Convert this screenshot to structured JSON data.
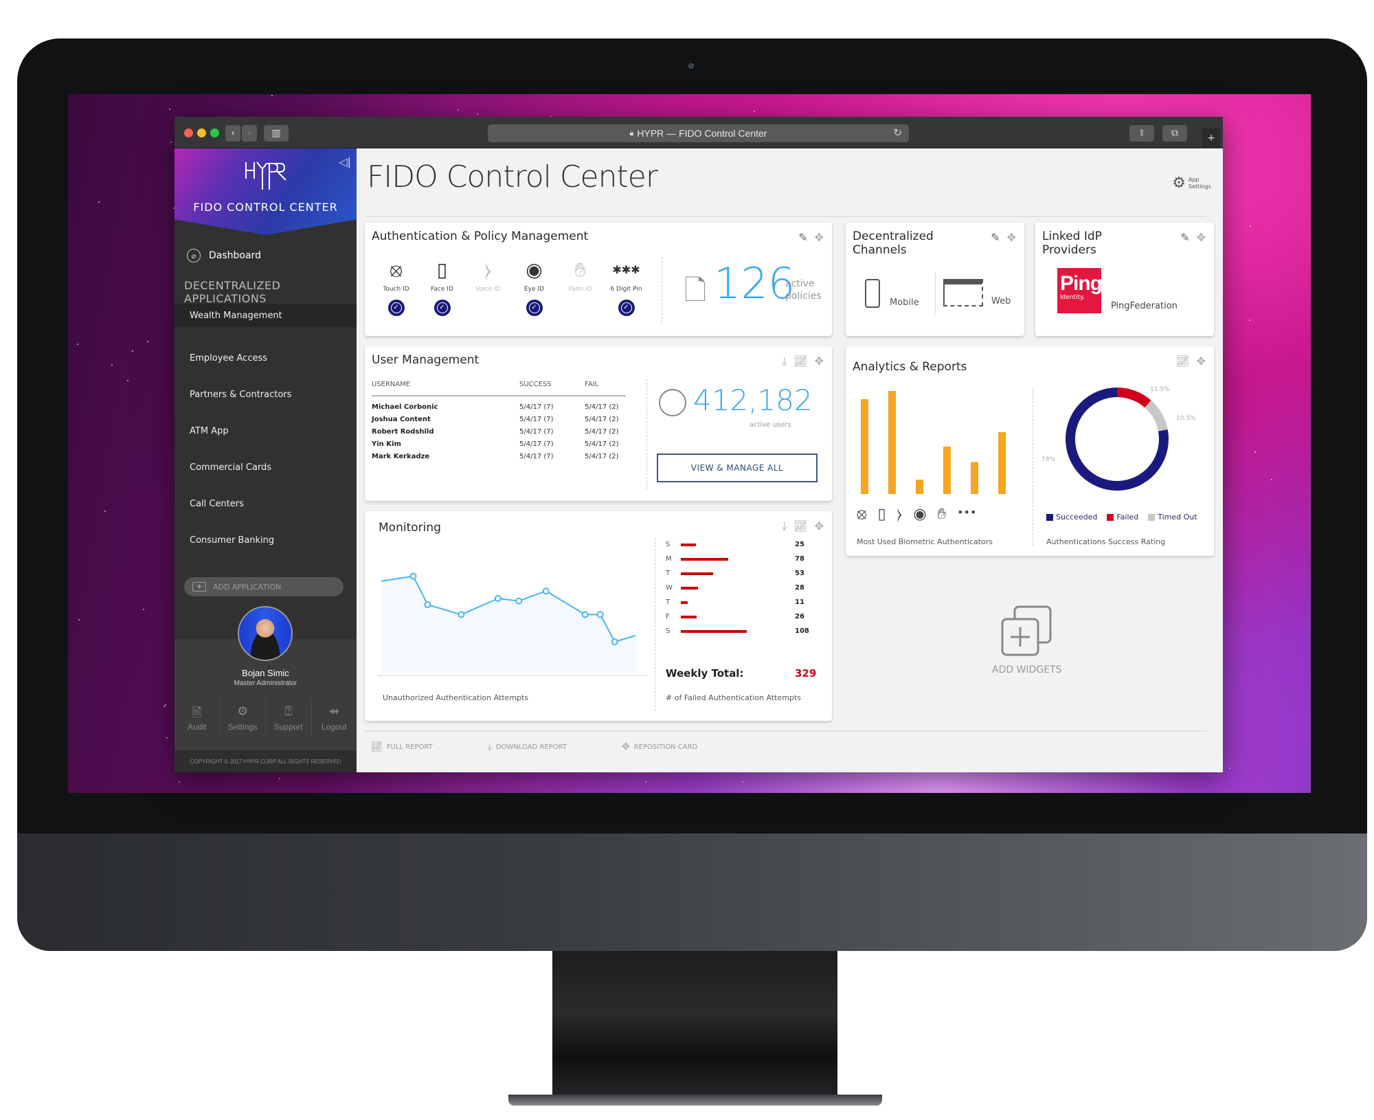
{
  "browser": {
    "url_title": "HYPR — FIDO Control Center",
    "traffic_lights": [
      "#fe5f57",
      "#febc2e",
      "#28c840"
    ]
  },
  "sidebar": {
    "brand_logo": "HYPR",
    "brand_title": "FIDO CONTROL CENTER",
    "dashboard_label": "Dashboard",
    "section_title": "DECENTRALIZED APPLICATIONS",
    "apps": [
      {
        "label": "Wealth Management",
        "active": true
      },
      {
        "label": "Employee Access"
      },
      {
        "label": "Partners & Contractors"
      },
      {
        "label": "ATM App"
      },
      {
        "label": "Commercial Cards"
      },
      {
        "label": "Call Centers"
      },
      {
        "label": "Consumer Banking"
      }
    ],
    "add_application_label": "ADD APPLICATION",
    "user": {
      "name": "Bojan Simic",
      "role": "Master Administrator"
    },
    "actions": [
      {
        "label": "Audit",
        "icon": "audit-icon"
      },
      {
        "label": "Settings",
        "icon": "gear-icon"
      },
      {
        "label": "Support",
        "icon": "help-icon"
      },
      {
        "label": "Logout",
        "icon": "logout-icon"
      }
    ],
    "copyright": "COPYRIGHT © 2017 HYPR CORP ALL RIGHTS RESERVED"
  },
  "main": {
    "page_title": "FIDO Control Center",
    "app_settings_label": "App Settings",
    "auth_policy": {
      "title": "Authentication & Policy Management",
      "methods": [
        {
          "label": "Touch ID",
          "icon": "fingerprint-icon",
          "enabled": true
        },
        {
          "label": "Face ID",
          "icon": "face-icon",
          "enabled": true
        },
        {
          "label": "Voice ID",
          "icon": "voice-icon",
          "enabled": false
        },
        {
          "label": "Eye ID",
          "icon": "eye-icon",
          "enabled": true
        },
        {
          "label": "Palm ID",
          "icon": "palm-icon",
          "enabled": false
        },
        {
          "label": "6 Digit Pin",
          "icon": "pin-icon",
          "enabled": true
        }
      ],
      "active_policies_count": "126",
      "active_policies_label1": "active",
      "active_policies_label2": "policies"
    },
    "channels": {
      "title": "Decentralized Channels",
      "items": [
        {
          "label": "Mobile"
        },
        {
          "label": "Web"
        }
      ]
    },
    "idp": {
      "title": "Linked IdP Providers",
      "logo_text": "Ping",
      "logo_sub": "Identity.",
      "provider_name": "PingFederation",
      "brand_color": "#e4173e"
    },
    "user_mgmt": {
      "title": "User Management",
      "columns": [
        "USERNAME",
        "SUCCESS",
        "FAIL"
      ],
      "rows": [
        {
          "name": "Michael Corbonic",
          "success": "5/4/17 (7)",
          "fail": "5/4/17 (2)"
        },
        {
          "name": "Joshua Content",
          "success": "5/4/17 (7)",
          "fail": "5/4/17 (2)"
        },
        {
          "name": "Robert Rodshild",
          "success": "5/4/17 (7)",
          "fail": "5/4/17 (2)"
        },
        {
          "name": "Yin Kim",
          "success": "5/4/17 (7)",
          "fail": "5/4/17 (2)"
        },
        {
          "name": "Mark Kerkadze",
          "success": "5/4/17 (7)",
          "fail": "5/4/17 (2)"
        }
      ],
      "active_users_count": "412,182",
      "active_users_label": "active users",
      "view_all_label": "VIEW & MANAGE ALL"
    },
    "monitoring": {
      "title": "Monitoring",
      "line_caption": "Unauthorized Authentication Attempts",
      "bar_caption": "# of Failed Authentication Attempts",
      "weekly_total_label": "Weekly Total:",
      "weekly_total_value": "329"
    },
    "analytics": {
      "title": "Analytics & Reports",
      "bar_caption": "Most Used Biometric Authenticators",
      "donut_caption": "Authentications Success Rating"
    },
    "add_widgets_label": "ADD WIDGETS",
    "footer": {
      "full_report": "FULL REPORT",
      "download_report": "DOWNLOAD REPORT",
      "reposition_card": "REPOSITION CARD"
    }
  },
  "chart_data": [
    {
      "type": "line",
      "title": "Unauthorized Authentication Attempts",
      "x": [
        0,
        1,
        2,
        3,
        4,
        5,
        6,
        7,
        8,
        9,
        10
      ],
      "values": [
        78,
        55,
        47,
        60,
        58,
        66,
        47,
        47,
        25,
        30
      ],
      "start_value": 74,
      "color": "#4ab4ec",
      "grid": false
    },
    {
      "type": "bar",
      "orientation": "horizontal",
      "title": "# of Failed Authentication Attempts",
      "categories": [
        "S",
        "M",
        "T",
        "W",
        "T",
        "F",
        "S"
      ],
      "values": [
        25,
        78,
        53,
        28,
        11,
        26,
        108
      ],
      "color": "#cc0000",
      "total": 329
    },
    {
      "type": "bar",
      "title": "Most Used Biometric Authenticators",
      "categories": [
        "Touch ID",
        "Face ID",
        "Voice ID",
        "Eye ID",
        "Palm ID",
        "Other"
      ],
      "values": [
        92,
        100,
        14,
        46,
        31,
        60
      ],
      "color": "#f5a623",
      "ylim": [
        0,
        100
      ]
    },
    {
      "type": "pie",
      "donut": true,
      "title": "Authentications Success Rating",
      "labels": [
        "Succeeded",
        "Failed",
        "Timed Out"
      ],
      "values": [
        78,
        11.5,
        10.5
      ],
      "value_labels": [
        "78%",
        "11.5%",
        "10.5%"
      ],
      "colors": [
        "#1a1a7e",
        "#d0021b",
        "#c8c8c8"
      ],
      "legend": "bottom"
    }
  ]
}
